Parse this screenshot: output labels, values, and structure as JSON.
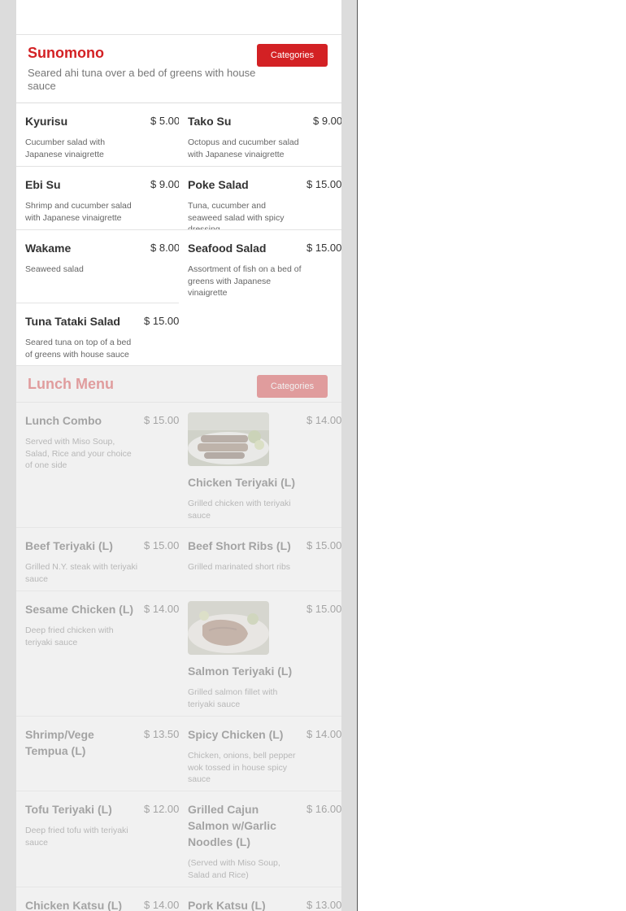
{
  "sunomono": {
    "title": "Sunomono",
    "description": "Seared ahi tuna over a bed of greens with house sauce",
    "categories_label": "Categories",
    "rows": [
      [
        {
          "name": "Kyurisu",
          "price": "$ 5.00",
          "desc": "Cucumber salad with Japanese vinaigrette"
        },
        {
          "name": "Tako Su",
          "price": "$ 9.00",
          "desc": "Octopus and cucumber salad with Japanese vinaigrette"
        }
      ],
      [
        {
          "name": "Ebi Su",
          "price": "$ 9.00",
          "desc": "Shrimp and cucumber salad with Japanese vinaigrette"
        },
        {
          "name": "Poke Salad",
          "price": "$ 15.00",
          "desc": "Tuna, cucumber and seaweed salad with spicy dressing"
        }
      ],
      [
        {
          "name": "Wakame",
          "price": "$ 8.00",
          "desc": "Seaweed salad"
        },
        {
          "name": "Seafood Salad",
          "price": "$ 15.00",
          "desc": "Assortment of fish on a bed of greens with Japanese vinaigrette"
        }
      ],
      [
        {
          "name": "Tuna Tataki Salad",
          "price": "$ 15.00",
          "desc": "Seared tuna on top of a bed of greens with house sauce"
        }
      ]
    ]
  },
  "lunch": {
    "title": "Lunch Menu",
    "categories_label": "Categories",
    "rows": [
      [
        {
          "name": "Lunch Combo",
          "price": "$ 15.00",
          "desc": "Served with Miso Soup, Salad, Rice and your choice of one side"
        },
        {
          "name": "Chicken Teriyaki (L)",
          "price": "$ 14.00",
          "desc": "Grilled chicken with teriyaki sauce",
          "photo": "chicken-teriyaki-photo"
        }
      ],
      [
        {
          "name": "Beef Teriyaki (L)",
          "price": "$ 15.00",
          "desc": "Grilled N.Y. steak with teriyaki sauce"
        },
        {
          "name": "Beef Short Ribs (L)",
          "price": "$ 15.00",
          "desc": "Grilled marinated short ribs"
        }
      ],
      [
        {
          "name": "Sesame Chicken (L)",
          "price": "$ 14.00",
          "desc": "Deep fried chicken with teriyaki sauce"
        },
        {
          "name": "Salmon Teriyaki (L)",
          "price": "$ 15.00",
          "desc": "Grilled salmon fillet with teriyaki sauce",
          "photo": "salmon-teriyaki-photo"
        }
      ],
      [
        {
          "name": "Shrimp/Vege Tempua (L)",
          "price": "$ 13.50",
          "desc": ""
        },
        {
          "name": "Spicy Chicken (L)",
          "price": "$ 14.00",
          "desc": "Chicken, onions, bell pepper wok tossed in house spicy sauce"
        }
      ],
      [
        {
          "name": "Tofu Teriyaki (L)",
          "price": "$ 12.00",
          "desc": "Deep fried tofu with teriyaki sauce"
        },
        {
          "name": "Grilled Cajun Salmon w/Garlic Noodles (L)",
          "price": "$ 16.00",
          "desc": "(Served with Miso Soup, Salad and Rice)"
        }
      ],
      [
        {
          "name": "Chicken Katsu (L)",
          "price": "$ 14.00",
          "desc": ""
        },
        {
          "name": "Pork Katsu (L)",
          "price": "$ 13.00",
          "desc": ""
        }
      ]
    ]
  },
  "colors": {
    "accent": "#d32124",
    "rail": "#dcdcdc",
    "muted_text": "#666666"
  }
}
